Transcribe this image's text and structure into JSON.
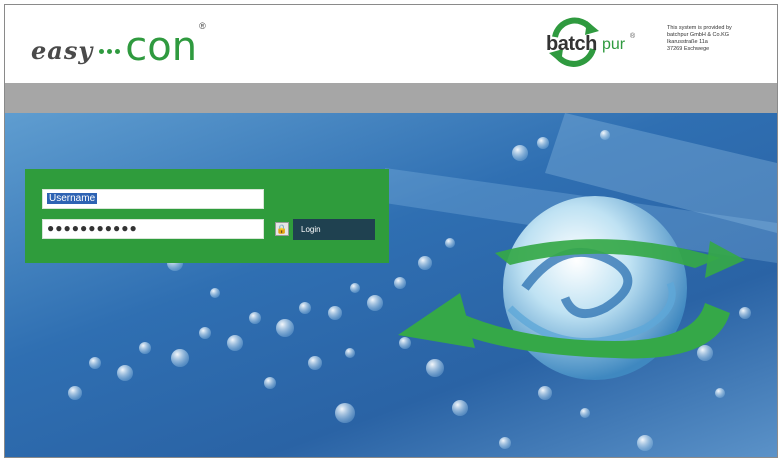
{
  "header": {
    "brand": {
      "easy": "easy",
      "con": "con",
      "registered": "®"
    },
    "partner": {
      "batch": "batch",
      "pur": "pur",
      "registered": "®"
    },
    "provider_lines": [
      "This system is provided by",
      "batchpur GmbH & Co.KG",
      "Ikarusstraße 11a",
      "37269 Eschwege"
    ]
  },
  "login": {
    "username_value": "Username",
    "password_mask": "●●●●●●●●●●●",
    "button_label": "Login"
  },
  "colors": {
    "brand_green": "#2f9a3f",
    "panel_green": "#2f9c3c",
    "bar_grey": "#a6a6a6",
    "button_dark": "#1f4150"
  }
}
